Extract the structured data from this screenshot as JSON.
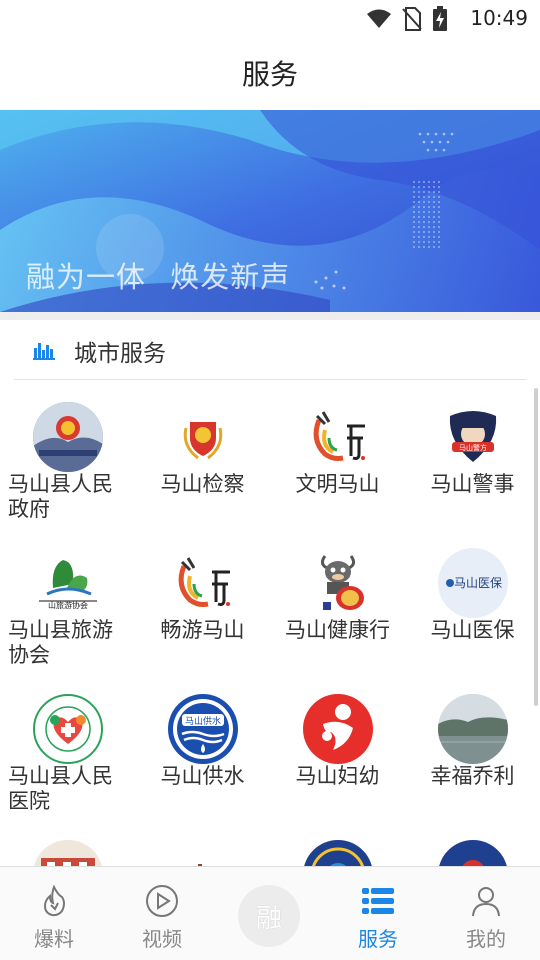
{
  "status_bar": {
    "time": "10:49"
  },
  "header": {
    "title": "服务"
  },
  "banner": {
    "slogan": "融为一体 焕发新声"
  },
  "section": {
    "title": "城市服务"
  },
  "services": [
    {
      "label": "马山县人民政府",
      "icon": "government-emblem-icon"
    },
    {
      "label": "马山检察",
      "icon": "procuratorate-emblem-icon"
    },
    {
      "label": "文明马山",
      "icon": "mashan-calligraphy-logo-icon"
    },
    {
      "label": "马山警事",
      "icon": "police-badge-icon"
    },
    {
      "label": "马山县旅游协会",
      "icon": "tourism-association-logo-icon"
    },
    {
      "label": "畅游马山",
      "icon": "mashan-calligraphy-logo-icon"
    },
    {
      "label": "马山健康行",
      "icon": "goat-mascot-drum-icon"
    },
    {
      "label": "马山医保",
      "icon": "medical-insurance-logo-icon"
    },
    {
      "label": "马山县人民医院",
      "icon": "hospital-heart-logo-icon"
    },
    {
      "label": "马山供水",
      "icon": "water-supply-logo-icon"
    },
    {
      "label": "马山妇幼",
      "icon": "maternal-child-logo-icon"
    },
    {
      "label": "幸福乔利",
      "icon": "landscape-photo-icon"
    }
  ],
  "tabs": [
    {
      "label": "爆料",
      "icon": "fire-icon",
      "active": false
    },
    {
      "label": "视频",
      "icon": "play-circle-icon",
      "active": false
    },
    {
      "label": "融",
      "icon": "center-logo-icon",
      "active": false
    },
    {
      "label": "服务",
      "icon": "list-icon",
      "active": true
    },
    {
      "label": "我的",
      "icon": "person-icon",
      "active": false
    }
  ],
  "colors": {
    "accent": "#1a86e6",
    "banner_blue": "#3a56d8"
  }
}
